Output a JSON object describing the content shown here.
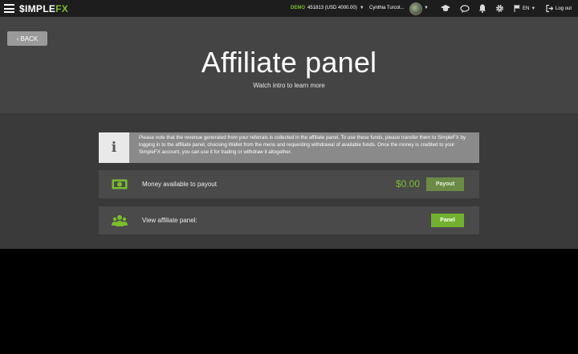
{
  "header": {
    "logo_simple": "$IMPLE",
    "logo_fx": "FX",
    "account_mode": "DEMO",
    "account_info": "451813 (USD 4000.00)",
    "user_name": "Cynthia Turcot...",
    "language": "EN",
    "logout_label": "Log out",
    "icons": [
      "menu-icon",
      "graduation-cap-icon",
      "chat-icon",
      "bell-icon",
      "gear-icon",
      "flag-icon",
      "logout-icon"
    ]
  },
  "hero": {
    "back_label": "BACK",
    "title": "Affiliate panel",
    "subtitle": "Watch intro to learn more"
  },
  "notice": {
    "icon": "i",
    "text": "Please note that the revenue generated from your referrals is collected in the affiliate panel. To use these funds, please transfer them to SimpleFX by logging in to the affiliate panel, choosing Wallet from the menu and requesting withdrawal of available funds. Once the money is credited to your SimpleFX account, you can use it for trading or withdraw it altogether."
  },
  "payout": {
    "label": "Money available to payout",
    "amount": "$0.00",
    "button": "Payout"
  },
  "affiliate": {
    "label": "View affiliate panel:",
    "button": "Panel"
  },
  "colors": {
    "accent": "#72b02f",
    "topbar": "#1d1d1d",
    "hero": "#444444",
    "content": "#3a3a3a"
  }
}
